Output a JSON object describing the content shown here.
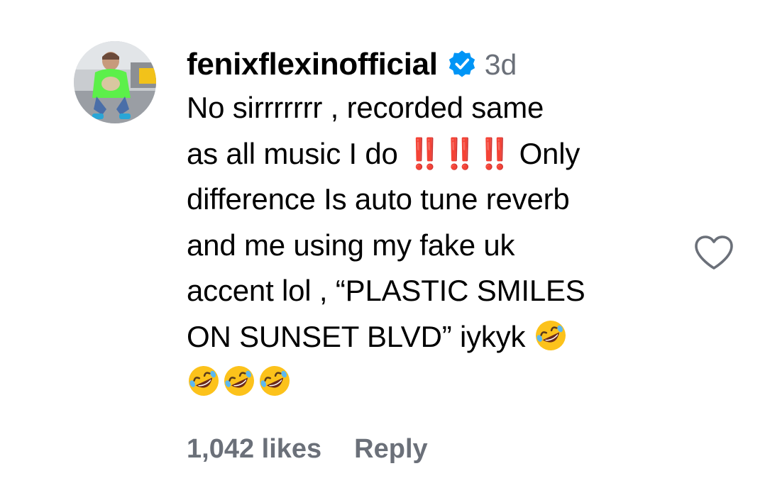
{
  "comment": {
    "username": "fenixflexinofficial",
    "timestamp": "3d",
    "lines": [
      "No sirrrrrrr , recorded same",
      "as all music I do",
      "Only",
      "difference Is auto tune reverb",
      "and me using my fake uk",
      "accent lol , “PLASTIC SMILES",
      "ON SUNSET BLVD” iykyk"
    ],
    "exclamations": "‼️‼️‼️"
  },
  "footer": {
    "likes_label": "1,042 likes",
    "reply_label": "Reply"
  },
  "icons": {
    "verified": "verified-badge-icon",
    "heart": "heart-outline-icon",
    "emoji": "rolling-on-floor-laughing-emoji"
  },
  "colors": {
    "verified_blue": "#0095f6",
    "muted_text": "#6b7079",
    "exclamation_red": "#e0162b"
  }
}
